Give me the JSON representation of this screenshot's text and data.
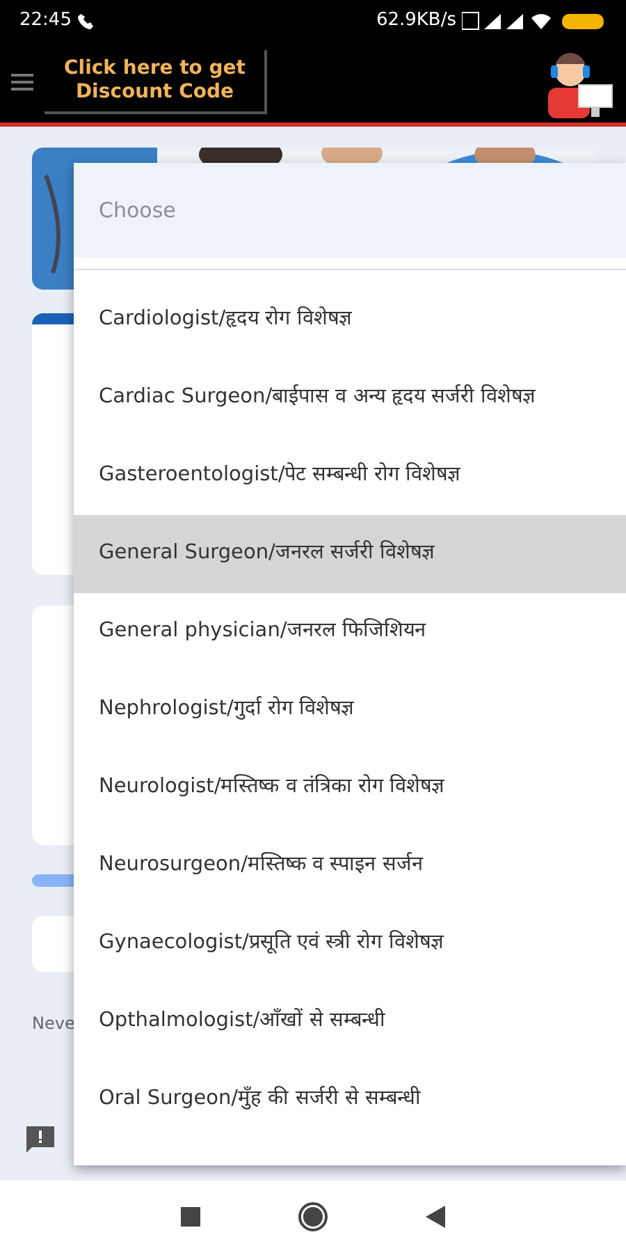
{
  "status_bar": {
    "time": "22:45",
    "speed": "62.9KB/s"
  },
  "app_bar": {
    "promo_lines": [
      "Click here to get",
      "Discount Code"
    ]
  },
  "form": {
    "note": "Neve"
  },
  "dropdown": {
    "placeholder": "Choose",
    "options": [
      {
        "label": "Cardiologist/हृदय रोग विशेषज्ञ",
        "selected": false
      },
      {
        "label": "Cardiac Surgeon/बाईपास व अन्य हृदय सर्जरी विशेषज्ञ",
        "selected": false
      },
      {
        "label": "Gasteroentologist/पेट सम्बन्धी रोग विशेषज्ञ",
        "selected": false
      },
      {
        "label": "General Surgeon/जनरल सर्जरी विशेषज्ञ",
        "selected": true
      },
      {
        "label": "General physician/जनरल फिजिशियन",
        "selected": false
      },
      {
        "label": "Nephrologist/गुर्दा रोग विशेषज्ञ",
        "selected": false
      },
      {
        "label": "Neurologist/मस्तिष्क व तंत्रिका रोग विशेषज्ञ",
        "selected": false
      },
      {
        "label": "Neurosurgeon/मस्तिष्क व स्पाइन सर्जन",
        "selected": false
      },
      {
        "label": "Gynaecologist/प्रसूति एवं स्त्री रोग विशेषज्ञ",
        "selected": false
      },
      {
        "label": "Opthalmologist/आँखों से सम्बन्धी",
        "selected": false
      },
      {
        "label": "Oral Surgeon/मुँह की सर्जरी से सम्बन्धी",
        "selected": false
      }
    ]
  }
}
